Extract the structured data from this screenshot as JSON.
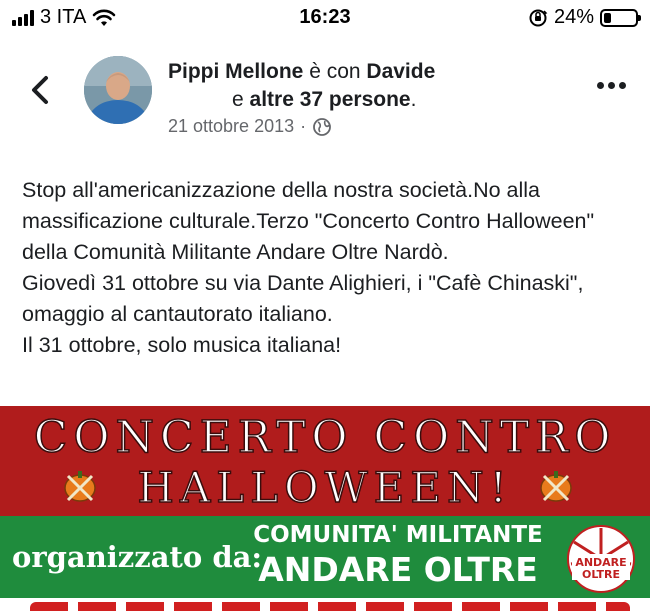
{
  "status_bar": {
    "carrier": "3 ITA",
    "time": "16:23",
    "battery": "24%",
    "battery_level": 0.24
  },
  "post": {
    "author": "Pippi Mellone",
    "with_text": "è con",
    "tagged": "Davide",
    "and_text": "e",
    "others": "altre 37 persone",
    "period": ".",
    "date": "21 ottobre 2013",
    "separator": "·",
    "paragraphs": [
      "Stop all'americanizzazione della nostra società.No alla massificazione culturale.Terzo \"Concerto Contro Halloween\" della Comunità Militante Andare Oltre Nardò.",
      "Giovedì 31 ottobre su via Dante Alighieri, i \"Cafè Chinaski\", omaggio al cantautorato italiano.",
      "Il 31 ottobre, solo musica italiana!"
    ]
  },
  "poster": {
    "line1": "CONCERTO CONTRO",
    "line2": "HALLOWEEN!",
    "organized_by": "organizzato da:",
    "org_line1": "COMUNITA' MILITANTE",
    "org_line2": "ANDARE OLTRE",
    "logo_text": "ANDARE OLTRE",
    "colors": {
      "red": "#b01c1c",
      "green": "#1f8c3d"
    }
  },
  "icons": [
    "signal-icon",
    "wifi-icon",
    "orientation-lock-icon",
    "battery-icon",
    "back-chevron-icon",
    "globe-icon",
    "more-options-icon"
  ]
}
